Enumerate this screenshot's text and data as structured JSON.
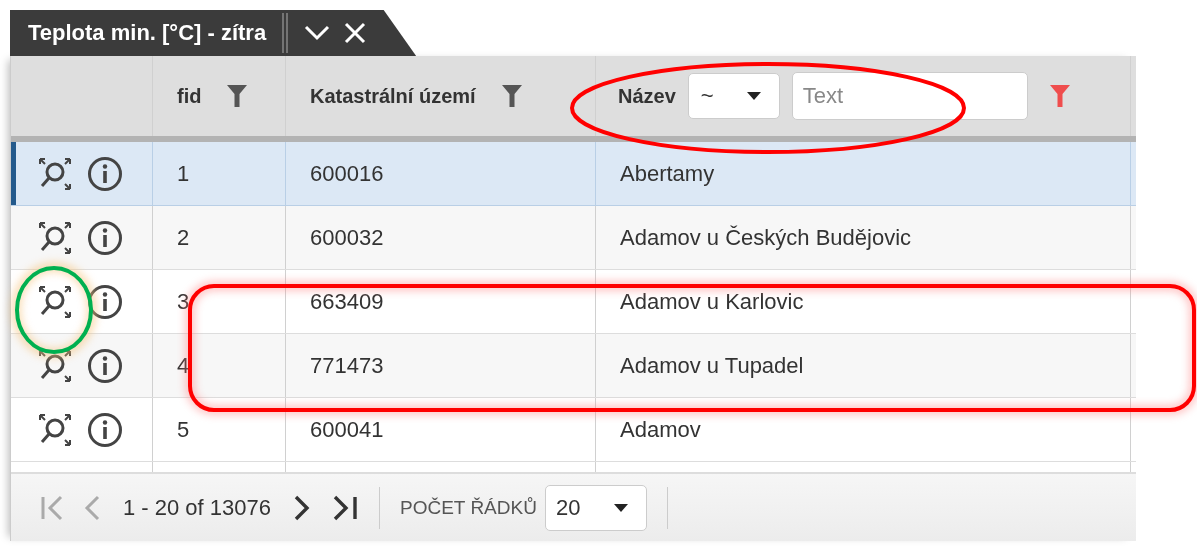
{
  "tab": {
    "title": "Teplota min. [°C] - zítra"
  },
  "columns": [
    {
      "label": "fid",
      "kind": "simple"
    },
    {
      "label": "Katastrální území",
      "kind": "simple"
    },
    {
      "label": "Název",
      "kind": "inline",
      "operator": "~",
      "placeholder": "Text",
      "filter_active": true
    }
  ],
  "rows": [
    {
      "fid": "1",
      "code": "600016",
      "name": "Abertamy",
      "selected": true
    },
    {
      "fid": "2",
      "code": "600032",
      "name": "Adamov u Českých Budějovic",
      "selected": false
    },
    {
      "fid": "3",
      "code": "663409",
      "name": "Adamov u Karlovic",
      "selected": false
    },
    {
      "fid": "4",
      "code": "771473",
      "name": "Adamov u Tupadel",
      "selected": false
    },
    {
      "fid": "5",
      "code": "600041",
      "name": "Adamov",
      "selected": false
    }
  ],
  "pager": {
    "buttons": [
      {
        "kind": "first",
        "disabled": true
      },
      {
        "kind": "prev",
        "disabled": true
      },
      {
        "kind": "next",
        "disabled": false
      },
      {
        "kind": "last",
        "disabled": false
      }
    ],
    "range": "1 - 20 of 13076",
    "page_size_label": "POČET ŘÁDKŮ",
    "page_size": "20"
  },
  "annotations": [
    {
      "kind": "ellipse",
      "color": "#ff0000"
    },
    {
      "kind": "circle",
      "color": "#00b050"
    },
    {
      "kind": "frame",
      "color": "#ff0000"
    }
  ]
}
